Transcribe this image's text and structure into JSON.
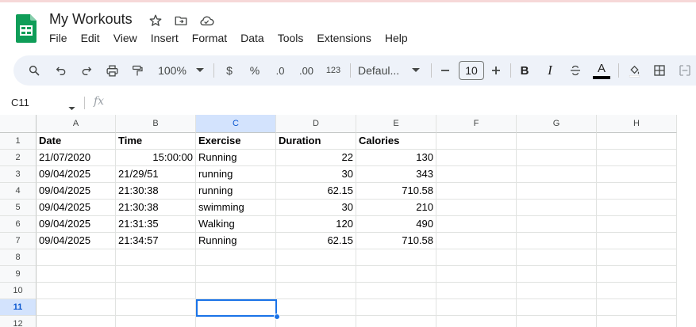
{
  "app": {
    "title": "My Workouts",
    "accent_color": "#0b57d0",
    "logo_color": "#0f9d58"
  },
  "title_icons": [
    "star-icon",
    "move-to-folder-icon",
    "cloud-status-icon"
  ],
  "menu": [
    "File",
    "Edit",
    "View",
    "Insert",
    "Format",
    "Data",
    "Tools",
    "Extensions",
    "Help"
  ],
  "toolbar": {
    "zoom": "100%",
    "currency": "$",
    "percent": "%",
    "decrease_decimal": ".0",
    "increase_decimal": ".00",
    "number_format": "123",
    "font": "Defaul...",
    "font_size": "10",
    "bold": "B",
    "italic": "I",
    "text_color": "A"
  },
  "formula_bar": {
    "name_box": "C11",
    "fx": "fx",
    "value": ""
  },
  "sheet": {
    "selected_cell": "C11",
    "columns": [
      "A",
      "B",
      "C",
      "D",
      "E",
      "F",
      "G",
      "H"
    ],
    "rows": [
      "1",
      "2",
      "3",
      "4",
      "5",
      "6",
      "7",
      "8",
      "9",
      "10",
      "11",
      "12"
    ],
    "header": [
      "Date",
      "Time",
      "Exercise",
      "Duration",
      "Calories"
    ],
    "data": [
      [
        "21/07/2020",
        "15:00:00",
        "Running",
        "22",
        "130"
      ],
      [
        "09/04/2025",
        "21/29/51",
        "running",
        "30",
        "343"
      ],
      [
        "09/04/2025",
        "21:30:38",
        "running",
        "62.15",
        "710.58"
      ],
      [
        "09/04/2025",
        "21:30:38",
        "swimming",
        "30",
        "210"
      ],
      [
        "09/04/2025",
        "21:31:35",
        "Walking",
        "120",
        "490"
      ],
      [
        "09/04/2025",
        "21:34:57",
        "Running",
        "62.15",
        "710.58"
      ]
    ]
  }
}
